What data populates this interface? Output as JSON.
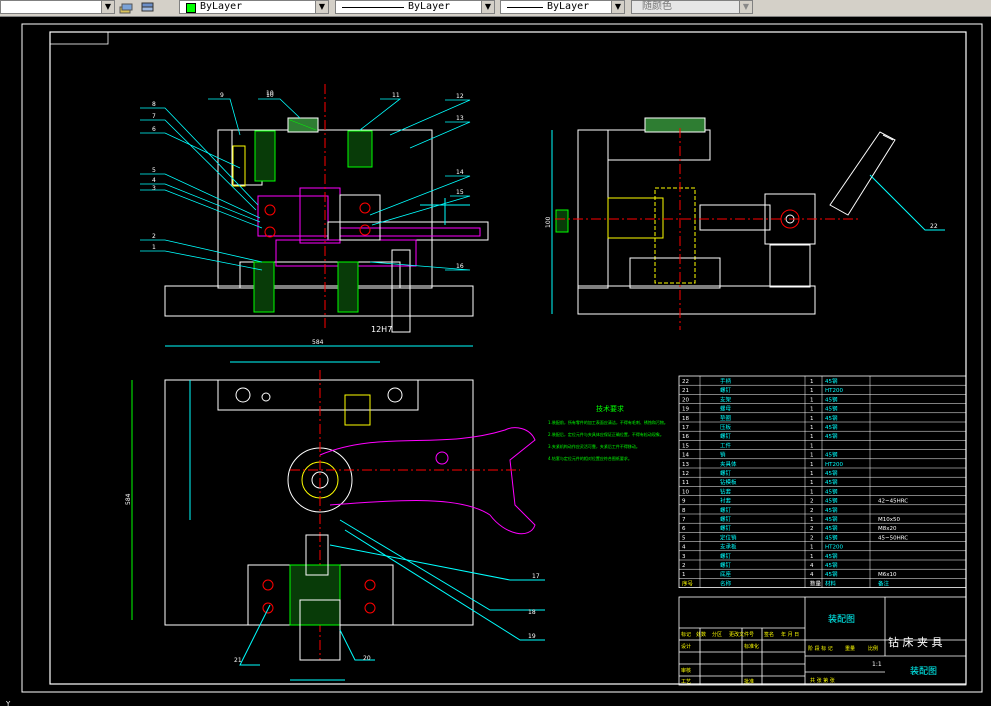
{
  "toolbar": {
    "color_combo": "ByLayer",
    "linetype_combo": "ByLayer",
    "lineweight_combo": "ByLayer",
    "plotstyle_combo": "随颜色",
    "color_swatch": "#00ff00"
  },
  "drawing": {
    "dimensions": {
      "d10": "10",
      "d12h7": "12H7",
      "d584": "584",
      "d584b": "584"
    },
    "tech_req_title": "技术要求",
    "tech_req_lines": [
      "1.装配前，所有零件的加工表面应清洁，不得有毛刺、锈蚀和污物。",
      "2.装配后，定位元件与夹具体应保证正确位置，不得有松动现象。",
      "3.夹紧机构动作应灵活可靠，夹紧后工件不得移动。",
      "4.钻套与定位元件的相对位置应符合图纸要求。"
    ],
    "balloons": [
      "1",
      "2",
      "3",
      "4",
      "5",
      "6",
      "7",
      "8",
      "9",
      "10",
      "11",
      "12",
      "13",
      "14",
      "15",
      "16",
      "17",
      "18",
      "19",
      "20",
      "21",
      "22"
    ],
    "bom_rows": [
      {
        "no": "22",
        "name": "手柄",
        "qty": "1",
        "mat": "45钢",
        "note": ""
      },
      {
        "no": "21",
        "name": "螺钉",
        "qty": "1",
        "mat": "HT200",
        "note": ""
      },
      {
        "no": "20",
        "name": "支架",
        "qty": "1",
        "mat": "45钢",
        "note": ""
      },
      {
        "no": "19",
        "name": "螺母",
        "qty": "1",
        "mat": "45钢",
        "note": ""
      },
      {
        "no": "18",
        "name": "垫圈",
        "qty": "1",
        "mat": "45钢",
        "note": ""
      },
      {
        "no": "17",
        "name": "压板",
        "qty": "1",
        "mat": "45钢",
        "note": ""
      },
      {
        "no": "16",
        "name": "螺钉",
        "qty": "1",
        "mat": "45钢",
        "note": ""
      },
      {
        "no": "15",
        "name": "工件",
        "qty": "1",
        "mat": "",
        "note": ""
      },
      {
        "no": "14",
        "name": "销",
        "qty": "1",
        "mat": "45钢",
        "note": ""
      },
      {
        "no": "13",
        "name": "夹具体",
        "qty": "1",
        "mat": "HT200",
        "note": ""
      },
      {
        "no": "12",
        "name": "螺钉",
        "qty": "1",
        "mat": "45钢",
        "note": ""
      },
      {
        "no": "11",
        "name": "钻模板",
        "qty": "1",
        "mat": "45钢",
        "note": ""
      },
      {
        "no": "10",
        "name": "钻套",
        "qty": "1",
        "mat": "45钢",
        "note": ""
      },
      {
        "no": "9",
        "name": "衬套",
        "qty": "2",
        "mat": "45钢",
        "note": "42~45HRC"
      },
      {
        "no": "8",
        "name": "螺钉",
        "qty": "2",
        "mat": "45钢",
        "note": ""
      },
      {
        "no": "7",
        "name": "螺钉",
        "qty": "1",
        "mat": "45钢",
        "note": "M10x50"
      },
      {
        "no": "6",
        "name": "螺钉",
        "qty": "2",
        "mat": "45钢",
        "note": "M8x20"
      },
      {
        "no": "5",
        "name": "定位销",
        "qty": "2",
        "mat": "45钢",
        "note": "45~50HRC"
      },
      {
        "no": "4",
        "name": "支承板",
        "qty": "1",
        "mat": "HT200",
        "note": ""
      },
      {
        "no": "3",
        "name": "螺钉",
        "qty": "1",
        "mat": "45钢",
        "note": ""
      },
      {
        "no": "2",
        "name": "螺钉",
        "qty": "4",
        "mat": "45钢",
        "note": ""
      },
      {
        "no": "1",
        "name": "底座",
        "qty": "4",
        "mat": "45钢",
        "note": "M6x10"
      }
    ],
    "bom_header": {
      "no": "序号",
      "name": "名称",
      "qty": "数量",
      "mat": "材料",
      "note": "备注"
    },
    "title_block": {
      "drawing_name": "装配图",
      "part_name": "钻 床 夹 具",
      "drawing_name2": "装配图",
      "scale": "1:1",
      "labels": [
        "标记",
        "处数",
        "分区",
        "更改文件号",
        "签名",
        "年 月 日"
      ],
      "design": "设计",
      "standard": "标准化",
      "review": "审核",
      "process": "工艺",
      "approve": "批准",
      "stage_labels": [
        "阶 段 标 记",
        "重量",
        "比例"
      ],
      "sheet": "共   张  第   张"
    }
  }
}
